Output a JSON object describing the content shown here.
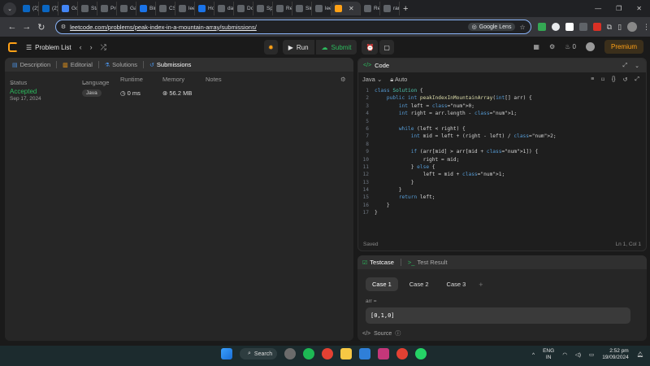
{
  "browser": {
    "tabs": [
      {
        "label": "(2)",
        "color": "#0a66c2"
      },
      {
        "label": "(2)",
        "color": "#0a66c2"
      },
      {
        "label": "Goo",
        "color": "#4285f4"
      },
      {
        "label": "Star",
        "color": "#5f6368"
      },
      {
        "label": "Pro",
        "color": "#5f6368"
      },
      {
        "label": "Gail",
        "color": "#5f6368"
      },
      {
        "label": "Bin",
        "color": "#1a73e8"
      },
      {
        "label": "CS",
        "color": "#5f6368"
      },
      {
        "label": "leet",
        "color": "#5f6368"
      },
      {
        "label": "How",
        "color": "#1a73e8"
      },
      {
        "label": "day",
        "color": "#5f6368"
      },
      {
        "label": "Dol",
        "color": "#5f6368"
      },
      {
        "label": "Spa",
        "color": "#5f6368"
      },
      {
        "label": "Res",
        "color": "#5f6368"
      },
      {
        "label": "Sim",
        "color": "#5f6368"
      },
      {
        "label": "leet",
        "color": "#5f6368"
      }
    ],
    "active_tab": {
      "label": "",
      "color": "#ffa116"
    },
    "tabs_after": [
      {
        "label": "Req",
        "color": "#5f6368"
      },
      {
        "label": "ram",
        "color": "#5f6368"
      }
    ],
    "url": "leetcode.com/problems/peak-index-in-a-mountain-array/submissions/",
    "lens_label": "Google Lens"
  },
  "lc_nav": {
    "problem_list": "Problem List",
    "run": "Run",
    "submit": "Submit",
    "streak_count": "0",
    "premium": "Premium"
  },
  "left_panel": {
    "tabs": [
      "Description",
      "Editorial",
      "Solutions",
      "Submissions"
    ],
    "columns": {
      "status": "Status",
      "language": "Language",
      "runtime": "Runtime",
      "memory": "Memory",
      "notes": "Notes"
    },
    "submissions": [
      {
        "status": "Accepted",
        "date": "Sep 17, 2024",
        "language": "Java",
        "runtime": "0 ms",
        "memory": "56.2 MB"
      }
    ]
  },
  "code_panel": {
    "title": "Code",
    "language": "Java",
    "auto": "Auto",
    "saved": "Saved",
    "position": "Ln 1, Col 1",
    "lines": [
      "class Solution {",
      "    public int peakIndexInMountainArray(int[] arr) {",
      "        int left = 0;",
      "        int right = arr.length - 1;",
      "",
      "        while (left < right) {",
      "            int mid = left + (right - left) / 2;",
      "",
      "            if (arr[mid] > arr[mid + 1]) {",
      "                right = mid;",
      "            } else {",
      "                left = mid + 1;",
      "            }",
      "        }",
      "        return left;",
      "    }",
      "}"
    ]
  },
  "test_panel": {
    "tabs": [
      "Testcase",
      "Test Result"
    ],
    "cases": [
      "Case 1",
      "Case 2",
      "Case 3"
    ],
    "arr_label": "arr =",
    "arr_value": "[0,1,0]",
    "source": "Source"
  },
  "taskbar": {
    "search": "Search",
    "lang_top": "ENG",
    "lang_bottom": "IN",
    "time": "2:52 pm",
    "date": "19/09/2024"
  }
}
